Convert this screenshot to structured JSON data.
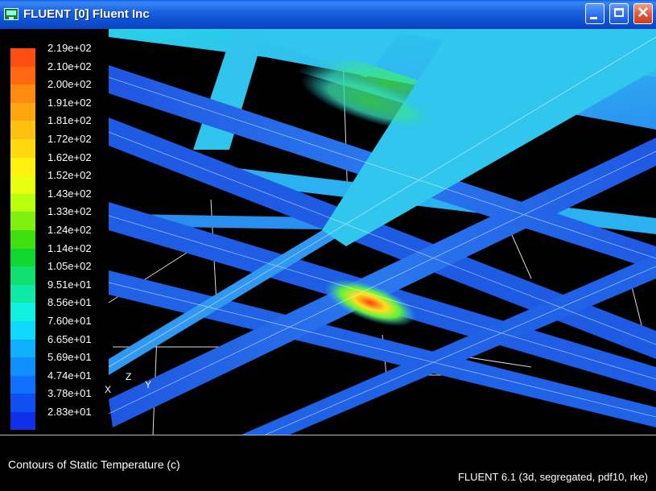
{
  "window": {
    "title": "FLUENT [0] Fluent Inc",
    "min_icon": "minimize-icon",
    "max_icon": "maximize-icon",
    "close_icon": "close-icon",
    "close_glyph": "✕"
  },
  "colorbar": {
    "labels": [
      "2.19e+02",
      "2.10e+02",
      "2.00e+02",
      "1.91e+02",
      "1.81e+02",
      "1.72e+02",
      "1.62e+02",
      "1.52e+02",
      "1.43e+02",
      "1.33e+02",
      "1.24e+02",
      "1.14e+02",
      "1.05e+02",
      "9.51e+01",
      "8.56e+01",
      "7.60e+01",
      "6.65e+01",
      "5.69e+01",
      "4.74e+01",
      "3.78e+01",
      "2.83e+01"
    ],
    "colors": [
      "#ff4c10",
      "#ff6a10",
      "#ff8a10",
      "#ffa510",
      "#ffc010",
      "#ffd810",
      "#fff010",
      "#e8ff10",
      "#b8ff10",
      "#80f010",
      "#40e010",
      "#10d830",
      "#10e070",
      "#10e8a8",
      "#10f0e0",
      "#10d8ff",
      "#10b0ff",
      "#1090ff",
      "#1070ff",
      "#1050f0",
      "#1030e8"
    ]
  },
  "axes": {
    "x": "X",
    "y": "Y",
    "z": "Z"
  },
  "status": {
    "left": "Contours of Static Temperature (c)",
    "right": "FLUENT 6.1 (3d, segregated, pdf10, rke)"
  },
  "palette": {
    "cool": "#1e5fe6",
    "mid": "#2fb8e8",
    "warm": "#38e07a",
    "hot": "#ff5020"
  }
}
